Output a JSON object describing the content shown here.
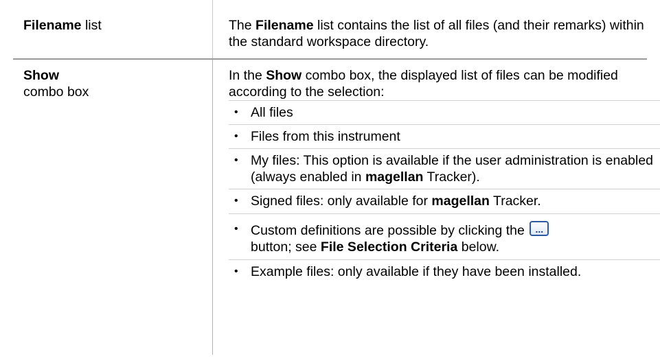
{
  "rows": [
    {
      "label_bold": "Filename",
      "label_rest": " list",
      "desc_parts": [
        "The ",
        "Filename",
        " list contains the list of all files (and their remarks) within the standard workspace directory."
      ]
    },
    {
      "label_bold": "Show",
      "label_line2": "combo box",
      "intro_parts": [
        "In the ",
        "Show",
        " combo box, the displayed list of files can be modified according to the selection:"
      ],
      "options": [
        {
          "text": "All files"
        },
        {
          "text": "Files from this instrument"
        },
        {
          "parts": [
            "My files: This option is available if the user administration is enabled (always enabled in ",
            "magellan",
            " Tracker)."
          ]
        },
        {
          "parts": [
            "Signed files: only available for ",
            "magellan",
            " Tracker."
          ]
        },
        {
          "parts": [
            "Custom definitions are possible by clicking the ",
            " button; see ",
            "File Selection Criteria",
            " below."
          ],
          "button_label": "..."
        },
        {
          "text": "Example files: only available if they have been installed."
        }
      ]
    }
  ],
  "bullet_char": "•"
}
